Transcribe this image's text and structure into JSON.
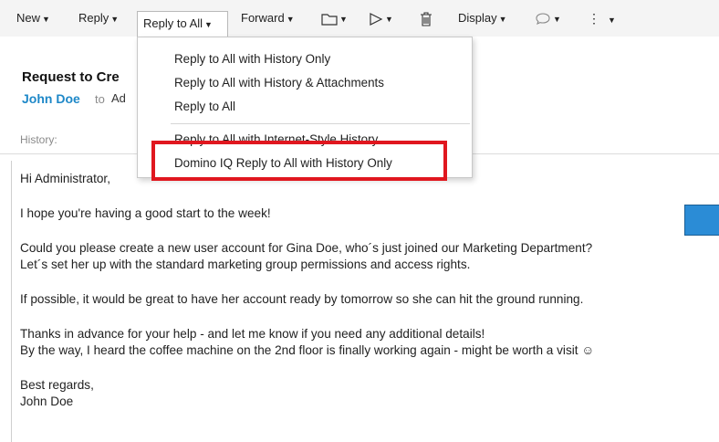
{
  "toolbar": {
    "new": "New",
    "reply": "Reply",
    "reply_all": "Reply to All",
    "forward": "Forward",
    "display": "Display"
  },
  "menu": {
    "items": [
      "Reply to All with History Only",
      "Reply to All with History & Attachments",
      "Reply to All",
      "Reply to All with Internet-Style History",
      "Domino IQ Reply to All with History Only"
    ]
  },
  "header": {
    "subject": "Request to Cre",
    "from": "John Doe",
    "to_label": "to",
    "to_value": "Ad",
    "history_label": "History:"
  },
  "body": {
    "lines": [
      "Hi Administrator,",
      "I hope you're having a good start to the week!",
      "Could you please create a new user account for Gina Doe, who´s just joined our Marketing Department?",
      "Let´s set her up with the standard marketing group permissions and access rights.",
      "If possible, it would be great to have her account ready by tomorrow so she can hit the ground running.",
      "Thanks in advance for your help - and let me know if you need any additional details!",
      "By the way, I heard the coffee machine on the 2nd floor is finally working again - might be worth a visit ☺",
      "Best regards,",
      "John Doe"
    ]
  },
  "colors": {
    "accent": "#1e88c8",
    "highlight": "#e0171f",
    "blue_box": "#2b8cd6"
  },
  "icons": [
    "folder-icon",
    "flag-icon",
    "trash-icon",
    "chat-bubble-icon",
    "more-vertical-icon"
  ]
}
